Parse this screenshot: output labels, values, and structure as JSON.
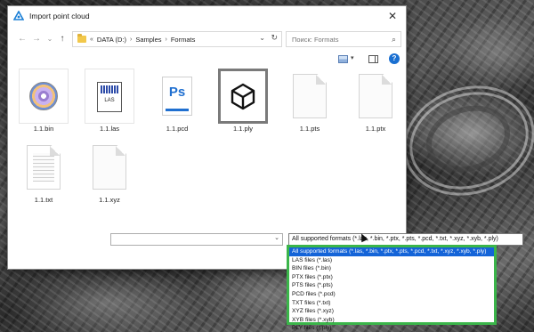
{
  "window": {
    "title": "Import point cloud",
    "close_glyph": "✕"
  },
  "navigation": {
    "back_glyph": "←",
    "forward_glyph": "→",
    "recent_glyph": "⌄",
    "up_glyph": "↑",
    "breadcrumb": [
      "«",
      "DATA (D:)",
      "Samples",
      "Formats"
    ],
    "separator": "›",
    "refresh_glyph": "↻",
    "dropdown_glyph": "⌄"
  },
  "search": {
    "placeholder": "Поиск: Formats",
    "icon": "⌕"
  },
  "toolbar": {
    "view_dropdown_glyph": "▾",
    "help_label": "?"
  },
  "files": [
    {
      "name": "1.1.bin",
      "icon": "disc-icon"
    },
    {
      "name": "1.1.las",
      "icon": "las-icon",
      "icon_text": "LAS"
    },
    {
      "name": "1.1.pcd",
      "icon": "photoshop-icon",
      "icon_text": "Ps"
    },
    {
      "name": "1.1.ply",
      "icon": "cube-icon"
    },
    {
      "name": "1.1.pts",
      "icon": "blank-document-icon"
    },
    {
      "name": "1.1.ptx",
      "icon": "blank-document-icon"
    },
    {
      "name": "1.1.txt",
      "icon": "text-document-icon"
    },
    {
      "name": "1.1.xyz",
      "icon": "blank-document-icon"
    }
  ],
  "filename_field": {
    "value": "",
    "chevron": "⌄"
  },
  "filter": {
    "selected": "All supported formats (*.las, *.bin, *.ptx, *.pts, *.pcd, *.txt, *.xyz, *.xyb, *.ply)",
    "options": [
      "All supported formats (*.las, *.bin, *.ptx, *.pts, *.pcd, *.txt, *.xyz, *.xyb, *.ply)",
      "LAS files (*.las)",
      "BIN files (*.bin)",
      "PTX files (*.ptx)",
      "PTS files (*.pts)",
      "PCD files (*.pcd)",
      "TXT files (*.txt)",
      "XYZ files (*.xyz)",
      "XYB files (*.xyb)",
      "PLY files (*.ply)"
    ],
    "highlight_color": "#3bb54a",
    "selection_color": "#1464d8"
  }
}
